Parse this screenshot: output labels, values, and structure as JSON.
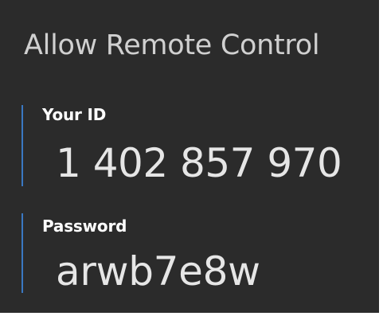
{
  "panel": {
    "title": "Allow Remote Control",
    "your_id": {
      "label": "Your ID",
      "value": "1 402 857 970"
    },
    "password": {
      "label": "Password",
      "value": "arwb7e8w"
    }
  },
  "colors": {
    "background": "#2b2b2b",
    "accent": "#3a78c2",
    "title_text": "#d0d0d0",
    "label_text": "#ffffff",
    "value_text": "#e6e6e6"
  }
}
